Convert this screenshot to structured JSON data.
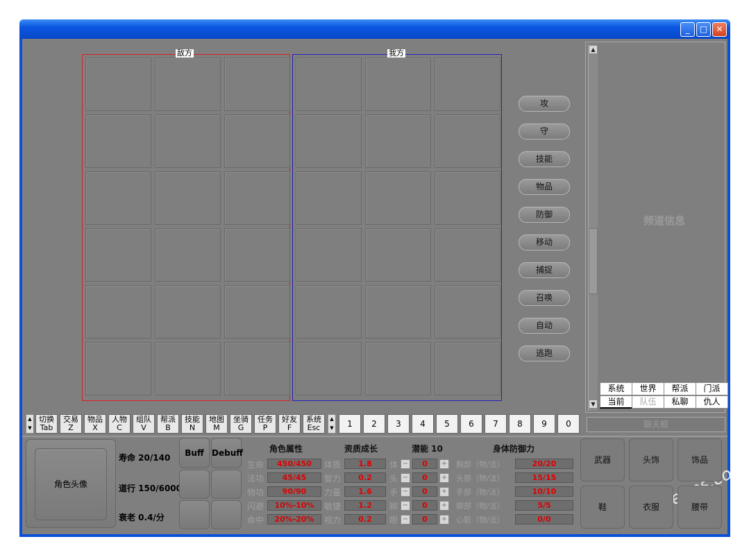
{
  "window": {
    "minimize_glyph": "_",
    "maximize_glyph": "□",
    "close_glyph": "✕"
  },
  "battle": {
    "enemy_label": "敌方",
    "ally_label": "我方"
  },
  "actions": [
    "攻",
    "守",
    "技能",
    "物品",
    "防御",
    "移动",
    "捕捉",
    "召唤",
    "自动",
    "逃跑"
  ],
  "chat": {
    "placeholder_label": "频道信息",
    "tabs_row1": [
      "系统",
      "世界",
      "帮派",
      "门派"
    ],
    "tabs_row2": [
      "当前",
      "队伍",
      "私聊",
      "仇人"
    ],
    "input_label": "聊天框"
  },
  "hotkeys": [
    {
      "label": "切换",
      "key": "Tab"
    },
    {
      "label": "交易",
      "key": "Z"
    },
    {
      "label": "物品",
      "key": "X"
    },
    {
      "label": "人物",
      "key": "C"
    },
    {
      "label": "组队",
      "key": "V"
    },
    {
      "label": "帮派",
      "key": "B"
    },
    {
      "label": "技能",
      "key": "N"
    },
    {
      "label": "地图",
      "key": "M"
    },
    {
      "label": "坐骑",
      "key": "G"
    },
    {
      "label": "任务",
      "key": "P"
    },
    {
      "label": "好友",
      "key": "F"
    },
    {
      "label": "系统",
      "key": "Esc"
    }
  ],
  "quickslots": [
    "1",
    "2",
    "3",
    "4",
    "5",
    "6",
    "7",
    "8",
    "9",
    "0"
  ],
  "status": {
    "avatar_label": "角色头像",
    "life": "寿命 20/140",
    "dao": "道行 150/6000",
    "decay": "衰老 0.4/分",
    "buff_label": "Buff",
    "debuff_label": "Debuff"
  },
  "attributes": {
    "header": "角色属性",
    "rows": [
      {
        "label": "生命",
        "value": "450/450"
      },
      {
        "label": "法功",
        "value": "45/45"
      },
      {
        "label": "物功",
        "value": "90/90"
      },
      {
        "label": "闪避",
        "value": "10%-10%"
      },
      {
        "label": "命中",
        "value": "20%-20%"
      }
    ]
  },
  "growth": {
    "header": "资质成长",
    "rows": [
      {
        "label": "体质",
        "value": "1.8"
      },
      {
        "label": "智力",
        "value": "0.2"
      },
      {
        "label": "力量",
        "value": "1.6"
      },
      {
        "label": "敏捷",
        "value": "1.2"
      },
      {
        "label": "视力",
        "value": "0.2"
      }
    ]
  },
  "potential": {
    "header": "潜能 10",
    "rows": [
      {
        "label": "体",
        "value": "0"
      },
      {
        "label": "头",
        "value": "0"
      },
      {
        "label": "手",
        "value": "0"
      },
      {
        "label": "脚",
        "value": "0"
      },
      {
        "label": "眼",
        "value": "0"
      }
    ],
    "minus": "−",
    "plus": "+"
  },
  "defense": {
    "header": "身体防御力",
    "rows": [
      {
        "label": "胸部（物/法）",
        "value": "20/20"
      },
      {
        "label": "头部（物/法）",
        "value": "15/15"
      },
      {
        "label": "手部（物/法）",
        "value": "10/10"
      },
      {
        "label": "脚部（物/法）",
        "value": "5/5"
      },
      {
        "label": "心脏（物/法）",
        "value": "0/0"
      }
    ]
  },
  "equipment": [
    "武器",
    "头饰",
    "饰品",
    "鞋",
    "衣服",
    "腰带"
  ],
  "watermark": "GameRes.com"
}
